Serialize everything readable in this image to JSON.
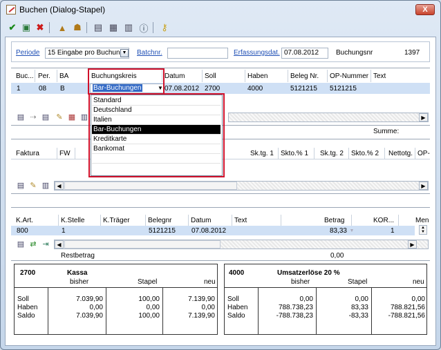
{
  "window": {
    "title": "Buchen (Dialog-Stapel)",
    "close_label": "X"
  },
  "toolbar": {
    "icons": [
      "check-icon",
      "import-icon",
      "delete-icon",
      "stamp-icon",
      "stamp-user-icon",
      "form-icon",
      "grid-icon",
      "list-icon",
      "info-icon",
      "key-icon"
    ]
  },
  "header": {
    "periode_label": "Periode",
    "periode_value": "15 Eingabe pro Buchung",
    "batch_label": "Batchnr.",
    "batch_value": "",
    "erfassung_label": "Erfassungsdat.",
    "erfassung_value": "07.08.2012",
    "buchungsnr_label": "Buchungsnr",
    "buchungsnr_value": "1397"
  },
  "grid1": {
    "columns": [
      "Buc...",
      "Per.",
      "BA",
      "Buchungskreis",
      "Datum",
      "Soll",
      "Haben",
      "Beleg Nr.",
      "OP-Nummer",
      "Text"
    ],
    "row": {
      "buc": "1",
      "per": "08",
      "ba": "B",
      "kreis": "Bar-Buchungen",
      "datum": "07.08.2012",
      "soll": "2700",
      "haben": "4000",
      "beleg": "5121215",
      "op": "5121215",
      "text": ""
    },
    "summe_label": "Summe:"
  },
  "dropdown": {
    "items": [
      "Standard",
      "Deutschland",
      "Italien",
      "Bar-Buchungen",
      "Kreditkarte",
      "Bankomat"
    ],
    "selected": "Bar-Buchungen"
  },
  "grid2": {
    "columns": [
      "Faktura",
      "FW",
      "Sk.tg. 1",
      "Skto.% 1",
      "Sk.tg. 2",
      "Skto.% 2",
      "Nettotg.",
      "OP-"
    ]
  },
  "grid3": {
    "columns": [
      "K.Art.",
      "K.Stelle",
      "K.Träger",
      "Belegnr",
      "Datum",
      "Text",
      "Betrag",
      "KOR...",
      "Men"
    ],
    "row": {
      "kart": "800",
      "kstelle": "1",
      "ktraeger": "",
      "belegnr": "5121215",
      "datum": "07.08.2012",
      "text": "",
      "betrag": "83,33",
      "kor": "",
      "men": "1"
    },
    "rest_label": "Restbetrag",
    "rest_value": "0,00"
  },
  "acct_left": {
    "number": "2700",
    "name": "Kassa",
    "col_bisher": "bisher",
    "col_stapel": "Stapel",
    "col_neu": "neu",
    "labels": [
      "Soll",
      "Haben",
      "Saldo"
    ],
    "bisher": [
      "7.039,90",
      "0,00",
      "7.039,90"
    ],
    "stapel": [
      "100,00",
      "0,00",
      "100,00"
    ],
    "neu": [
      "7.139,90",
      "0,00",
      "7.139,90"
    ]
  },
  "acct_right": {
    "number": "4000",
    "name": "Umsatzerlöse 20 %",
    "col_bisher": "bisher",
    "col_stapel": "Stapel",
    "col_neu": "neu",
    "labels": [
      "Soll",
      "Haben",
      "Saldo"
    ],
    "bisher": [
      "0,00",
      "788.738,23",
      "-788.738,23"
    ],
    "stapel": [
      "0,00",
      "83,33",
      "-83,33"
    ],
    "neu": [
      "0,00",
      "788.821,56",
      "-788.821,56"
    ]
  }
}
